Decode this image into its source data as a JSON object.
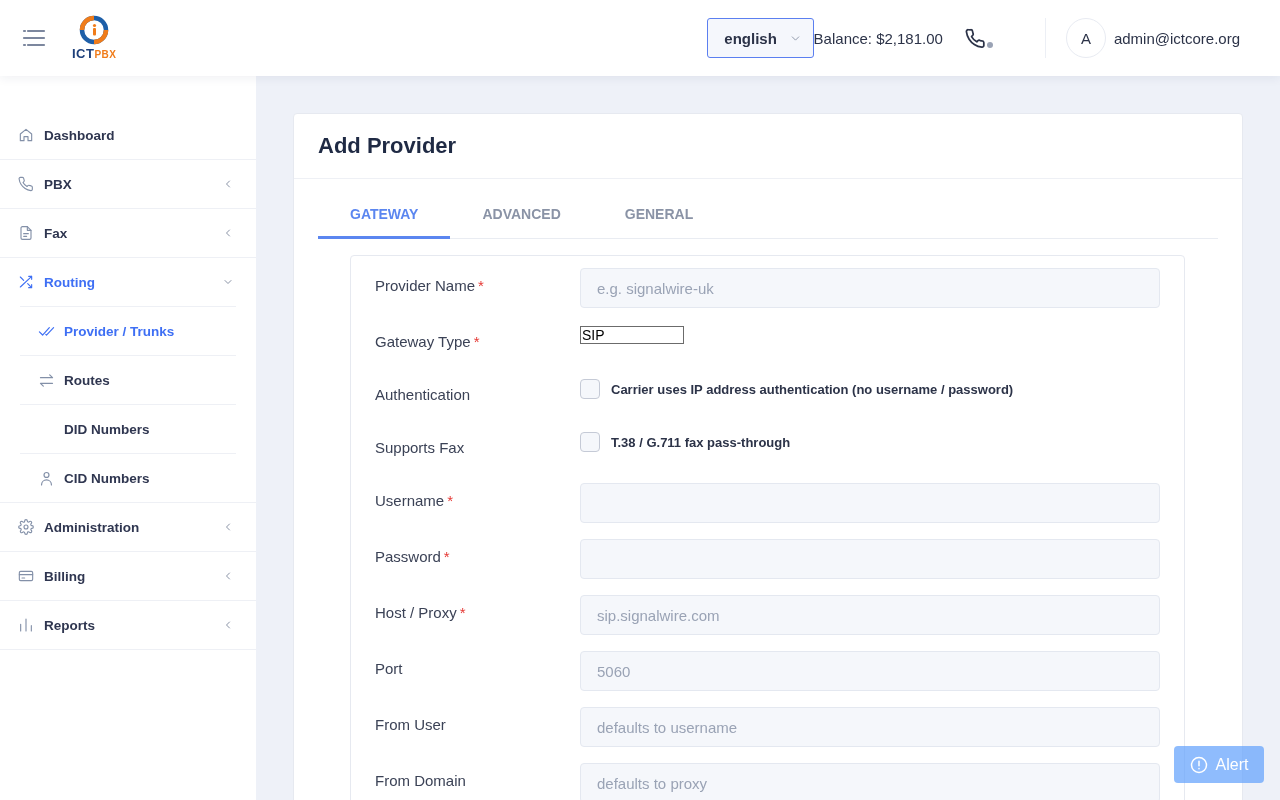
{
  "header": {
    "logo": {
      "name": "ICT",
      "suffix": "PBX"
    },
    "language_select": {
      "value": "english"
    },
    "balance": "Balance: $2,181.00",
    "user": {
      "initial": "A",
      "email": "admin@ictcore.org"
    }
  },
  "sidebar": {
    "items": [
      {
        "kind": "link",
        "label": "Dashboard",
        "selected": false
      },
      {
        "kind": "group",
        "label": "PBX",
        "selected": false,
        "expanded": false
      },
      {
        "kind": "group",
        "label": "Fax",
        "selected": false,
        "expanded": false
      },
      {
        "kind": "group",
        "label": "Routing",
        "selected": true,
        "expanded": true,
        "children": [
          {
            "label": "Provider / Trunks",
            "selected": true
          },
          {
            "label": "Routes",
            "selected": false
          },
          {
            "label": "DID Numbers",
            "selected": false
          },
          {
            "label": "CID Numbers",
            "selected": false
          }
        ]
      },
      {
        "kind": "group",
        "label": "Administration",
        "selected": false,
        "expanded": false
      },
      {
        "kind": "group",
        "label": "Billing",
        "selected": false,
        "expanded": false
      },
      {
        "kind": "group",
        "label": "Reports",
        "selected": false,
        "expanded": false
      }
    ]
  },
  "page": {
    "title": "Add Provider",
    "tabs": [
      {
        "label": "GATEWAY",
        "selected": true
      },
      {
        "label": "ADVANCED",
        "selected": false
      },
      {
        "label": "GENERAL",
        "selected": false
      }
    ],
    "form": {
      "fields": [
        {
          "kind": "text",
          "label": "Provider Name",
          "required_mark": "*",
          "placeholder": "e.g. signalwire-uk"
        },
        {
          "kind": "select",
          "label": "Gateway Type",
          "required_mark": "*",
          "value": "SIP"
        },
        {
          "kind": "checkbox",
          "label": "Authentication",
          "option": "Carrier uses IP address authentication (no username / password)",
          "checked": false
        },
        {
          "kind": "checkbox",
          "label": "Supports Fax",
          "option": "T.38 / G.711 fax pass-through",
          "checked": false
        },
        {
          "kind": "text",
          "label": "Username",
          "required_mark": "*"
        },
        {
          "kind": "password",
          "label": "Password",
          "required_mark": "*"
        },
        {
          "kind": "text",
          "label": "Host / Proxy",
          "required_mark": "*",
          "placeholder": "sip.signalwire.com"
        },
        {
          "kind": "text",
          "label": "Port",
          "placeholder": "5060"
        },
        {
          "kind": "text",
          "label": "From User",
          "placeholder": "defaults to username"
        },
        {
          "kind": "text",
          "label": "From Domain",
          "placeholder": "defaults to proxy"
        }
      ]
    }
  },
  "alert_button": {
    "label": "Alert"
  }
}
